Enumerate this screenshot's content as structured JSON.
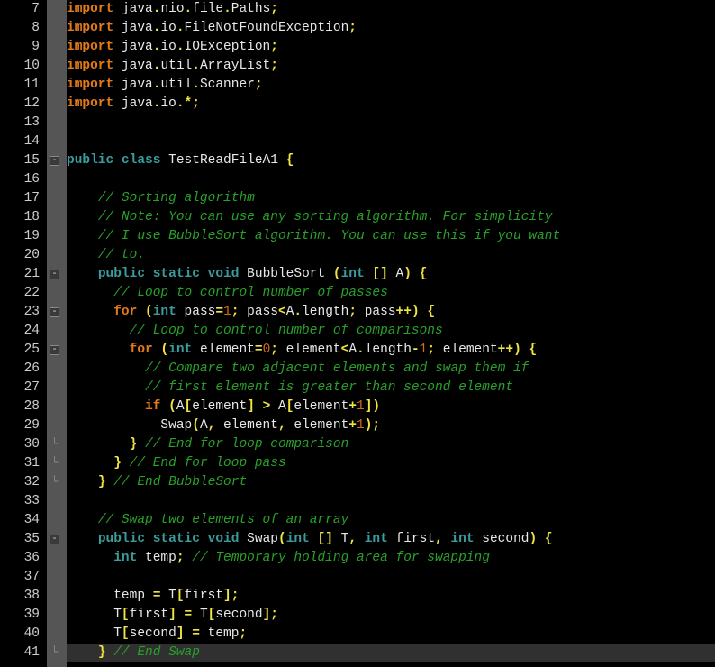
{
  "editor": {
    "first_line": 7,
    "caret_line": 41,
    "fold_markers": [
      {
        "line": 15,
        "type": "open"
      },
      {
        "line": 21,
        "type": "open"
      },
      {
        "line": 23,
        "type": "open"
      },
      {
        "line": 25,
        "type": "open"
      },
      {
        "line": 30,
        "type": "close"
      },
      {
        "line": 31,
        "type": "close"
      },
      {
        "line": 32,
        "type": "close"
      },
      {
        "line": 35,
        "type": "open"
      },
      {
        "line": 41,
        "type": "close"
      }
    ],
    "lines": [
      {
        "n": 7,
        "t": [
          [
            "kw-orange",
            "import"
          ],
          [
            "txt",
            " java"
          ],
          [
            "op-yellow",
            "."
          ],
          [
            "txt",
            "nio"
          ],
          [
            "op-yellow",
            "."
          ],
          [
            "txt",
            "file"
          ],
          [
            "op-yellow",
            "."
          ],
          [
            "txt",
            "Paths"
          ],
          [
            "op-yellow",
            ";"
          ]
        ]
      },
      {
        "n": 8,
        "t": [
          [
            "kw-orange",
            "import"
          ],
          [
            "txt",
            " java"
          ],
          [
            "op-yellow",
            "."
          ],
          [
            "txt",
            "io"
          ],
          [
            "op-yellow",
            "."
          ],
          [
            "txt",
            "FileNotFoundException"
          ],
          [
            "op-yellow",
            ";"
          ]
        ]
      },
      {
        "n": 9,
        "t": [
          [
            "kw-orange",
            "import"
          ],
          [
            "txt",
            " java"
          ],
          [
            "op-yellow",
            "."
          ],
          [
            "txt",
            "io"
          ],
          [
            "op-yellow",
            "."
          ],
          [
            "txt",
            "IOException"
          ],
          [
            "op-yellow",
            ";"
          ]
        ]
      },
      {
        "n": 10,
        "t": [
          [
            "kw-orange",
            "import"
          ],
          [
            "txt",
            " java"
          ],
          [
            "op-yellow",
            "."
          ],
          [
            "txt",
            "util"
          ],
          [
            "op-yellow",
            "."
          ],
          [
            "txt",
            "ArrayList"
          ],
          [
            "op-yellow",
            ";"
          ]
        ]
      },
      {
        "n": 11,
        "t": [
          [
            "kw-orange",
            "import"
          ],
          [
            "txt",
            " java"
          ],
          [
            "op-yellow",
            "."
          ],
          [
            "txt",
            "util"
          ],
          [
            "op-yellow",
            "."
          ],
          [
            "txt",
            "Scanner"
          ],
          [
            "op-yellow",
            ";"
          ]
        ]
      },
      {
        "n": 12,
        "t": [
          [
            "kw-orange",
            "import"
          ],
          [
            "txt",
            " java"
          ],
          [
            "op-yellow",
            "."
          ],
          [
            "txt",
            "io"
          ],
          [
            "op-yellow",
            "."
          ],
          [
            "op-yellow",
            "*"
          ],
          [
            "op-yellow",
            ";"
          ]
        ]
      },
      {
        "n": 13,
        "t": []
      },
      {
        "n": 14,
        "t": []
      },
      {
        "n": 15,
        "t": [
          [
            "kw-teal",
            "public"
          ],
          [
            "txt",
            " "
          ],
          [
            "kw-teal",
            "class"
          ],
          [
            "txt",
            " TestReadFileA1 "
          ],
          [
            "op-yellow",
            "{"
          ]
        ]
      },
      {
        "n": 16,
        "t": []
      },
      {
        "n": 17,
        "t": [
          [
            "txt",
            "    "
          ],
          [
            "cm-green",
            "// Sorting algorithm"
          ]
        ]
      },
      {
        "n": 18,
        "t": [
          [
            "txt",
            "    "
          ],
          [
            "cm-green",
            "// Note: You can use any sorting algorithm. For simplicity"
          ]
        ]
      },
      {
        "n": 19,
        "t": [
          [
            "txt",
            "    "
          ],
          [
            "cm-green",
            "// I use BubbleSort algorithm. You can use this if you want"
          ]
        ]
      },
      {
        "n": 20,
        "t": [
          [
            "txt",
            "    "
          ],
          [
            "cm-green",
            "// to."
          ]
        ]
      },
      {
        "n": 21,
        "t": [
          [
            "txt",
            "    "
          ],
          [
            "kw-teal",
            "public"
          ],
          [
            "txt",
            " "
          ],
          [
            "kw-teal",
            "static"
          ],
          [
            "txt",
            " "
          ],
          [
            "kw-teal",
            "void"
          ],
          [
            "txt",
            " BubbleSort "
          ],
          [
            "op-yellow",
            "("
          ],
          [
            "kw-teal",
            "int"
          ],
          [
            "txt",
            " "
          ],
          [
            "op-yellow",
            "[]"
          ],
          [
            "txt",
            " A"
          ],
          [
            "op-yellow",
            ")"
          ],
          [
            "txt",
            " "
          ],
          [
            "op-yellow",
            "{"
          ]
        ]
      },
      {
        "n": 22,
        "t": [
          [
            "txt",
            "      "
          ],
          [
            "cm-green",
            "// Loop to control number of passes"
          ]
        ]
      },
      {
        "n": 23,
        "t": [
          [
            "txt",
            "      "
          ],
          [
            "kw-orange",
            "for"
          ],
          [
            "txt",
            " "
          ],
          [
            "op-yellow",
            "("
          ],
          [
            "kw-teal",
            "int"
          ],
          [
            "txt",
            " pass"
          ],
          [
            "op-yellow",
            "="
          ],
          [
            "num-orange",
            "1"
          ],
          [
            "op-yellow",
            ";"
          ],
          [
            "txt",
            " pass"
          ],
          [
            "op-yellow",
            "<"
          ],
          [
            "txt",
            "A"
          ],
          [
            "op-yellow",
            "."
          ],
          [
            "txt",
            "length"
          ],
          [
            "op-yellow",
            ";"
          ],
          [
            "txt",
            " pass"
          ],
          [
            "op-yellow",
            "++"
          ],
          [
            "op-yellow",
            ")"
          ],
          [
            "txt",
            " "
          ],
          [
            "op-yellow",
            "{"
          ]
        ]
      },
      {
        "n": 24,
        "t": [
          [
            "txt",
            "        "
          ],
          [
            "cm-green",
            "// Loop to control number of comparisons"
          ]
        ]
      },
      {
        "n": 25,
        "t": [
          [
            "txt",
            "        "
          ],
          [
            "kw-orange",
            "for"
          ],
          [
            "txt",
            " "
          ],
          [
            "op-yellow",
            "("
          ],
          [
            "kw-teal",
            "int"
          ],
          [
            "txt",
            " element"
          ],
          [
            "op-yellow",
            "="
          ],
          [
            "num-orange",
            "0"
          ],
          [
            "op-yellow",
            ";"
          ],
          [
            "txt",
            " element"
          ],
          [
            "op-yellow",
            "<"
          ],
          [
            "txt",
            "A"
          ],
          [
            "op-yellow",
            "."
          ],
          [
            "txt",
            "length"
          ],
          [
            "op-yellow",
            "-"
          ],
          [
            "num-orange",
            "1"
          ],
          [
            "op-yellow",
            ";"
          ],
          [
            "txt",
            " element"
          ],
          [
            "op-yellow",
            "++"
          ],
          [
            "op-yellow",
            ")"
          ],
          [
            "txt",
            " "
          ],
          [
            "op-yellow",
            "{"
          ]
        ]
      },
      {
        "n": 26,
        "t": [
          [
            "txt",
            "          "
          ],
          [
            "cm-green",
            "// Compare two adjacent elements and swap them if"
          ]
        ]
      },
      {
        "n": 27,
        "t": [
          [
            "txt",
            "          "
          ],
          [
            "cm-green",
            "// first element is greater than second element"
          ]
        ]
      },
      {
        "n": 28,
        "t": [
          [
            "txt",
            "          "
          ],
          [
            "kw-orange",
            "if"
          ],
          [
            "txt",
            " "
          ],
          [
            "op-yellow",
            "("
          ],
          [
            "txt",
            "A"
          ],
          [
            "op-yellow",
            "["
          ],
          [
            "txt",
            "element"
          ],
          [
            "op-yellow",
            "]"
          ],
          [
            "txt",
            " "
          ],
          [
            "op-yellow",
            ">"
          ],
          [
            "txt",
            " A"
          ],
          [
            "op-yellow",
            "["
          ],
          [
            "txt",
            "element"
          ],
          [
            "op-yellow",
            "+"
          ],
          [
            "num-orange",
            "1"
          ],
          [
            "op-yellow",
            "]"
          ],
          [
            "op-yellow",
            ")"
          ]
        ]
      },
      {
        "n": 29,
        "t": [
          [
            "txt",
            "            Swap"
          ],
          [
            "op-yellow",
            "("
          ],
          [
            "txt",
            "A"
          ],
          [
            "op-yellow",
            ","
          ],
          [
            "txt",
            " element"
          ],
          [
            "op-yellow",
            ","
          ],
          [
            "txt",
            " element"
          ],
          [
            "op-yellow",
            "+"
          ],
          [
            "num-orange",
            "1"
          ],
          [
            "op-yellow",
            ")"
          ],
          [
            "op-yellow",
            ";"
          ]
        ]
      },
      {
        "n": 30,
        "t": [
          [
            "txt",
            "        "
          ],
          [
            "op-yellow",
            "}"
          ],
          [
            "txt",
            " "
          ],
          [
            "cm-green",
            "// End for loop comparison"
          ]
        ]
      },
      {
        "n": 31,
        "t": [
          [
            "txt",
            "      "
          ],
          [
            "op-yellow",
            "}"
          ],
          [
            "txt",
            " "
          ],
          [
            "cm-green",
            "// End for loop pass"
          ]
        ]
      },
      {
        "n": 32,
        "t": [
          [
            "txt",
            "    "
          ],
          [
            "op-yellow",
            "}"
          ],
          [
            "txt",
            " "
          ],
          [
            "cm-green",
            "// End BubbleSort"
          ]
        ]
      },
      {
        "n": 33,
        "t": []
      },
      {
        "n": 34,
        "t": [
          [
            "txt",
            "    "
          ],
          [
            "cm-green",
            "// Swap two elements of an array"
          ]
        ]
      },
      {
        "n": 35,
        "t": [
          [
            "txt",
            "    "
          ],
          [
            "kw-teal",
            "public"
          ],
          [
            "txt",
            " "
          ],
          [
            "kw-teal",
            "static"
          ],
          [
            "txt",
            " "
          ],
          [
            "kw-teal",
            "void"
          ],
          [
            "txt",
            " Swap"
          ],
          [
            "op-yellow",
            "("
          ],
          [
            "kw-teal",
            "int"
          ],
          [
            "txt",
            " "
          ],
          [
            "op-yellow",
            "[]"
          ],
          [
            "txt",
            " T"
          ],
          [
            "op-yellow",
            ","
          ],
          [
            "txt",
            " "
          ],
          [
            "kw-teal",
            "int"
          ],
          [
            "txt",
            " first"
          ],
          [
            "op-yellow",
            ","
          ],
          [
            "txt",
            " "
          ],
          [
            "kw-teal",
            "int"
          ],
          [
            "txt",
            " second"
          ],
          [
            "op-yellow",
            ")"
          ],
          [
            "txt",
            " "
          ],
          [
            "op-yellow",
            "{"
          ]
        ]
      },
      {
        "n": 36,
        "t": [
          [
            "txt",
            "      "
          ],
          [
            "kw-teal",
            "int"
          ],
          [
            "txt",
            " temp"
          ],
          [
            "op-yellow",
            ";"
          ],
          [
            "txt",
            " "
          ],
          [
            "cm-green",
            "// Temporary holding area for swapping"
          ]
        ]
      },
      {
        "n": 37,
        "t": []
      },
      {
        "n": 38,
        "t": [
          [
            "txt",
            "      temp "
          ],
          [
            "op-yellow",
            "="
          ],
          [
            "txt",
            " T"
          ],
          [
            "op-yellow",
            "["
          ],
          [
            "txt",
            "first"
          ],
          [
            "op-yellow",
            "]"
          ],
          [
            "op-yellow",
            ";"
          ]
        ]
      },
      {
        "n": 39,
        "t": [
          [
            "txt",
            "      T"
          ],
          [
            "op-yellow",
            "["
          ],
          [
            "txt",
            "first"
          ],
          [
            "op-yellow",
            "]"
          ],
          [
            "txt",
            " "
          ],
          [
            "op-yellow",
            "="
          ],
          [
            "txt",
            " T"
          ],
          [
            "op-yellow",
            "["
          ],
          [
            "txt",
            "second"
          ],
          [
            "op-yellow",
            "]"
          ],
          [
            "op-yellow",
            ";"
          ]
        ]
      },
      {
        "n": 40,
        "t": [
          [
            "txt",
            "      T"
          ],
          [
            "op-yellow",
            "["
          ],
          [
            "txt",
            "second"
          ],
          [
            "op-yellow",
            "]"
          ],
          [
            "txt",
            " "
          ],
          [
            "op-yellow",
            "="
          ],
          [
            "txt",
            " temp"
          ],
          [
            "op-yellow",
            ";"
          ]
        ]
      },
      {
        "n": 41,
        "t": [
          [
            "txt",
            "    "
          ],
          [
            "op-yellow",
            "}"
          ],
          [
            "txt",
            " "
          ],
          [
            "cm-green",
            "// End Swap"
          ]
        ]
      }
    ]
  }
}
